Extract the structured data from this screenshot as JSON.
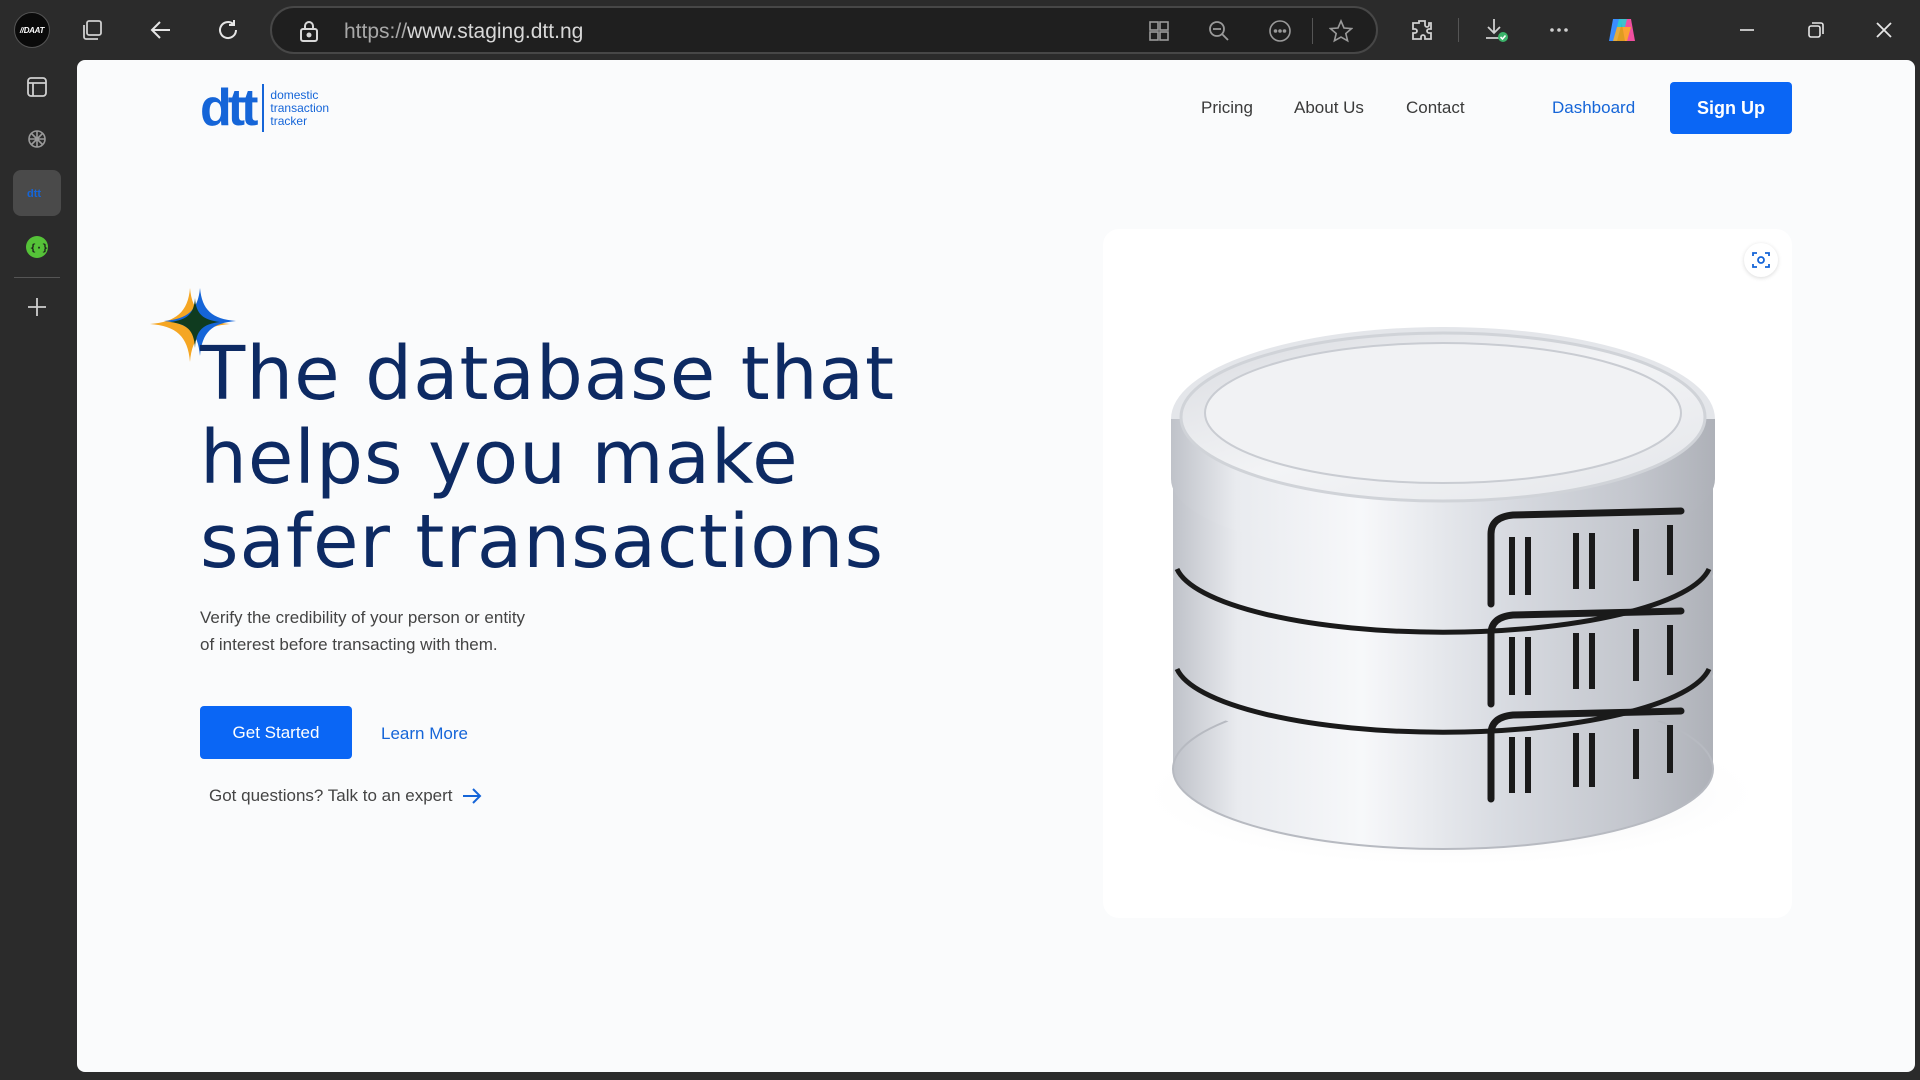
{
  "browser": {
    "profile_label": "//DAAT",
    "url_protocol": "https://",
    "url_host": "www.staging.dtt.ng"
  },
  "site": {
    "logo": {
      "mark": "dtt",
      "line1": "domestic",
      "line2": "transaction",
      "line3": "tracker"
    },
    "nav": {
      "pricing": "Pricing",
      "about": "About Us",
      "contact": "Contact",
      "dashboard": "Dashboard",
      "signup": "Sign Up"
    },
    "hero": {
      "title_line1": "The database that",
      "title_line2": "helps you make",
      "title_line3": "safer transactions",
      "subtitle_line1": "Verify the credibility of your person or entity",
      "subtitle_line2": "of interest before transacting with them.",
      "get_started": "Get Started",
      "learn_more": "Learn More",
      "questions": "Got questions? Talk to an expert"
    }
  },
  "colors": {
    "brand_blue": "#0a66f5",
    "title_navy": "#0d2a63",
    "sparkle_orange": "#f5a623",
    "sparkle_green": "#0f3b1f"
  },
  "icons": [
    "tab-actions-icon",
    "workspaces-icon",
    "back-icon",
    "refresh-icon",
    "lock-icon",
    "app-available-icon",
    "zoom-out-icon",
    "reading-icon",
    "favorite-icon",
    "extensions-icon",
    "downloads-icon",
    "more-icon",
    "copilot-icon",
    "minimize-icon",
    "restore-icon",
    "close-icon",
    "arrow-right-icon",
    "scan-icon"
  ]
}
